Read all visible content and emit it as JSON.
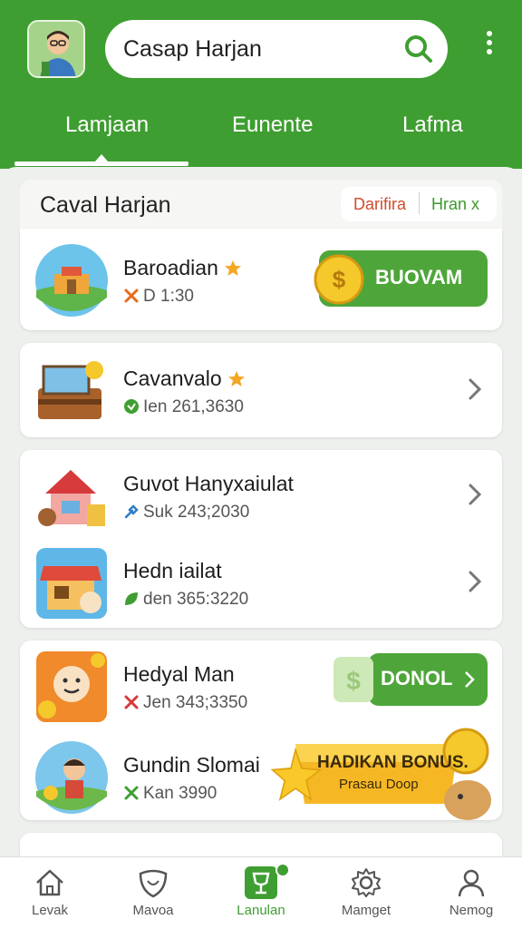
{
  "header": {
    "search_value": "Casap Harjan",
    "tabs": [
      {
        "label": "Lamjaan"
      },
      {
        "label": "Eunente"
      },
      {
        "label": "Lafma"
      }
    ]
  },
  "section": {
    "title": "Caval Harjan",
    "chip_left": "Darifira",
    "chip_right": "Hran x"
  },
  "items": [
    {
      "title": "Baroadian",
      "sub": "D 1:30",
      "action": "BUOVAM"
    },
    {
      "title": "Cavanvalo",
      "sub": "Ien 261,3630"
    },
    {
      "title": "Guvot Hanyxaiulat",
      "sub": "Suk 243;2030"
    },
    {
      "title": "Hedn iailat",
      "sub": "den 365:3220"
    },
    {
      "title": "Hedyal Man",
      "sub": "Jen 343;3350",
      "action": "DONOL"
    },
    {
      "title": "Gundin Slomai",
      "sub": "Kan 3990"
    }
  ],
  "bonus": {
    "line1": "HADIKAN BONUS.",
    "line2": "Prasau Doop"
  },
  "bottom_nav": [
    {
      "label": "Levak",
      "icon": "home-icon"
    },
    {
      "label": "Mavoa",
      "icon": "heart-shield-icon"
    },
    {
      "label": "Lanulan",
      "icon": "trophy-icon"
    },
    {
      "label": "Mamget",
      "icon": "gear-icon"
    },
    {
      "label": "Nemog",
      "icon": "user-icon"
    }
  ],
  "colors": {
    "brand_green": "#3f9e32",
    "accent_orange": "#f5a623"
  }
}
